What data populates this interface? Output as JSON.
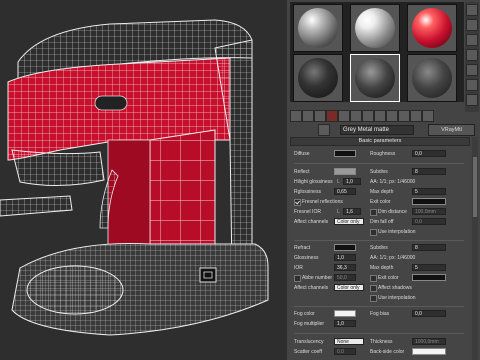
{
  "viewport": {
    "label": "3D viewport - coffee machine model"
  },
  "material_editor": {
    "material_name": "Grey Metal matte",
    "material_type": "VRayMtl",
    "rollout_title": "Basic parameters",
    "diffuse": {
      "label": "Diffuse",
      "roughness_label": "Roughness",
      "roughness": "0,0"
    },
    "reflect": {
      "label": "Reflect",
      "glossiness_label": "Hilight glossiness",
      "glossiness_lock": "L",
      "glossiness_value": "1,0",
      "refl_gloss_label": "Rglossiness",
      "refl_gloss_value": "0,65",
      "fresnel_label": "Fresnel reflections",
      "fresnel_ior_label": "Fresnel IOR",
      "fresnel_ior_lock": "L",
      "fresnel_ior_value": "1,6",
      "affect_channels_label": "Affect channels",
      "affect_channels_value": "Color only",
      "subdivs_label": "Subdivs",
      "subdivs_value": "8",
      "aa_label": "AA: 1/1; px: 1/46000",
      "max_depth_label": "Max depth",
      "max_depth_value": "5",
      "exit_color_label": "Exit color",
      "dim_distance_label": "Dim distance",
      "dim_distance_value": "100,0mm",
      "dim_falloff_label": "Dim fall off",
      "dim_falloff_value": "0,0",
      "use_interp_label": "Use interpolation"
    },
    "refract": {
      "label": "Refract",
      "glossiness_label": "Glossiness",
      "glossiness_value": "1,0",
      "ior_label": "IOR",
      "ior_value": "36,3",
      "abbe_label": "Abbe number",
      "abbe_value": "50,0",
      "affect_channels_label": "Affect channels",
      "affect_channels_value": "Color only",
      "subdivs_label": "Subdivs",
      "subdivs_value": "8",
      "aa_label": "AA: 1/1; px: 1/46000",
      "max_depth_label": "Max depth",
      "max_depth_value": "5",
      "exit_color_label": "Exit color",
      "affect_shadows_label": "Affect shadows",
      "use_interp_label": "Use interpolation"
    },
    "fog": {
      "color_label": "Fog color",
      "multiplier_label": "Fog multiplier",
      "multiplier_value": "1,0",
      "bias_label": "Fog bias",
      "bias_value": "0,0"
    },
    "translucency": {
      "label": "Translucency",
      "mode_value": "None",
      "thickness_label": "Thickness",
      "thickness_value": "1000,0mm",
      "scatter_label": "Scatter coeff",
      "scatter_value": "0,0",
      "back_side_label": "Back-side color"
    }
  },
  "colors": {
    "accent_red": "#c8102e",
    "wire": "#e6e6e6",
    "panel": "#454545"
  }
}
